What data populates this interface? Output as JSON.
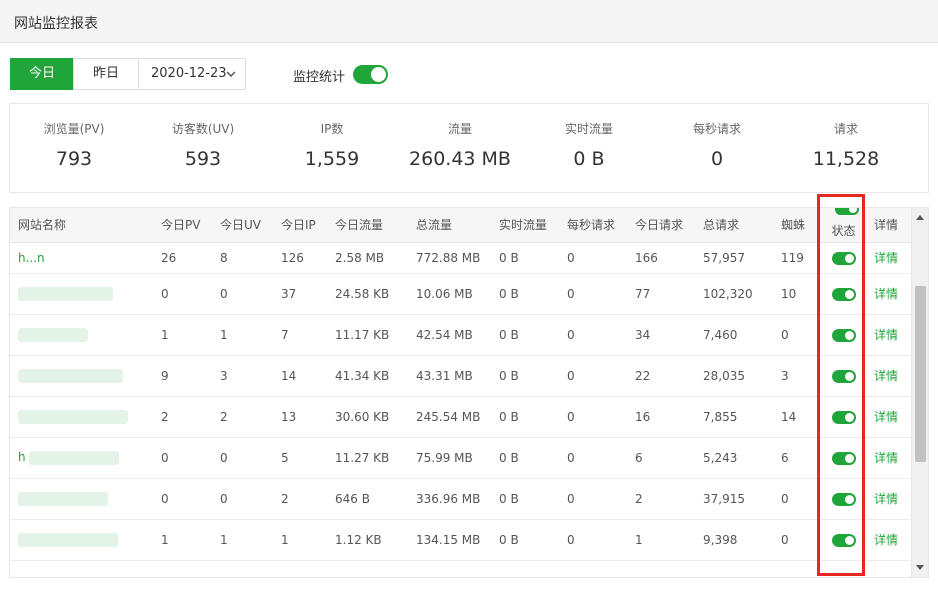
{
  "window": {
    "title": "网站监控报表"
  },
  "toolbar": {
    "today_label": "今日",
    "yesterday_label": "昨日",
    "date_value": "2020-12-23",
    "monitor_label": "监控统计",
    "monitor_on": true
  },
  "stats": [
    {
      "label": "浏览量(PV)",
      "value": "793"
    },
    {
      "label": "访客数(UV)",
      "value": "593"
    },
    {
      "label": "IP数",
      "value": "1,559"
    },
    {
      "label": "流量",
      "value": "260.43 MB"
    },
    {
      "label": "实时流量",
      "value": "0 B"
    },
    {
      "label": "每秒请求",
      "value": "0"
    },
    {
      "label": "请求",
      "value": "11,528"
    }
  ],
  "table": {
    "headers": {
      "site": "网站名称",
      "pv": "今日PV",
      "uv": "今日UV",
      "ip": "今日IP",
      "traffic": "今日流量",
      "total_traffic": "总流量",
      "realtime": "实时流量",
      "rps": "每秒请求",
      "req": "今日请求",
      "total_req": "总请求",
      "spider": "蜘蛛",
      "status": "状态",
      "detail": "详情"
    },
    "rows": [
      {
        "site": "h...n",
        "pv": "26",
        "uv": "8",
        "ip": "126",
        "traffic": "2.58 MB",
        "total_traffic": "772.88 MB",
        "realtime": "0 B",
        "rps": "0",
        "req": "166",
        "total_req": "57,957",
        "spider": "119",
        "detail": "详情"
      },
      {
        "site": "",
        "pv": "0",
        "uv": "0",
        "ip": "37",
        "traffic": "24.58 KB",
        "total_traffic": "10.06 MB",
        "realtime": "0 B",
        "rps": "0",
        "req": "77",
        "total_req": "102,320",
        "spider": "10",
        "detail": "详情"
      },
      {
        "site": "",
        "pv": "1",
        "uv": "1",
        "ip": "7",
        "traffic": "11.17 KB",
        "total_traffic": "42.54 MB",
        "realtime": "0 B",
        "rps": "0",
        "req": "34",
        "total_req": "7,460",
        "spider": "0",
        "detail": "详情"
      },
      {
        "site": "",
        "pv": "9",
        "uv": "3",
        "ip": "14",
        "traffic": "41.34 KB",
        "total_traffic": "43.31 MB",
        "realtime": "0 B",
        "rps": "0",
        "req": "22",
        "total_req": "28,035",
        "spider": "3",
        "detail": "详情"
      },
      {
        "site": "",
        "pv": "2",
        "uv": "2",
        "ip": "13",
        "traffic": "30.60 KB",
        "total_traffic": "245.54 MB",
        "realtime": "0 B",
        "rps": "0",
        "req": "16",
        "total_req": "7,855",
        "spider": "14",
        "detail": "详情"
      },
      {
        "site": "h",
        "pv": "0",
        "uv": "0",
        "ip": "5",
        "traffic": "11.27 KB",
        "total_traffic": "75.99 MB",
        "realtime": "0 B",
        "rps": "0",
        "req": "6",
        "total_req": "5,243",
        "spider": "6",
        "detail": "详情"
      },
      {
        "site": "",
        "pv": "0",
        "uv": "0",
        "ip": "2",
        "traffic": "646 B",
        "total_traffic": "336.96 MB",
        "realtime": "0 B",
        "rps": "0",
        "req": "2",
        "total_req": "37,915",
        "spider": "0",
        "detail": "详情"
      },
      {
        "site": "",
        "pv": "1",
        "uv": "1",
        "ip": "1",
        "traffic": "1.12 KB",
        "total_traffic": "134.15 MB",
        "realtime": "0 B",
        "rps": "0",
        "req": "1",
        "total_req": "9,398",
        "spider": "0",
        "detail": "详情"
      }
    ]
  },
  "colors": {
    "accent": "#20a53a",
    "highlight": "#e8271f"
  },
  "icons": {
    "date_dropdown": "chevron-down-icon"
  }
}
